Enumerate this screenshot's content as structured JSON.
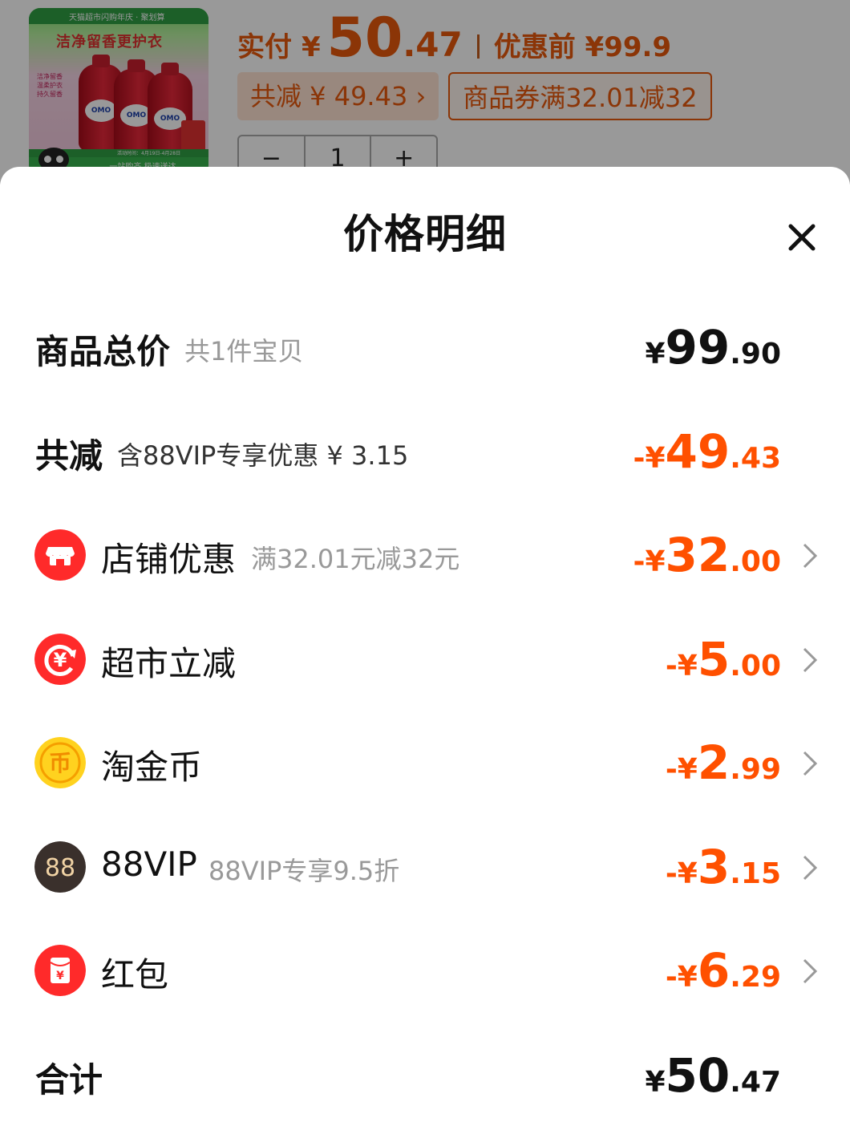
{
  "background": {
    "product_banner_text": "天猫超市闪购年庆 · 聚划算",
    "product_slogan": "洁净留香更护衣",
    "product_side_note": "洁净留香 温柔护衣 持久留香",
    "product_date_text": "活动时间：4月19日-4月28日",
    "product_ship_text": "一站购齐 极速送达",
    "bottle_label": "OMO",
    "pay_label": "实付",
    "pay_yen": "¥",
    "pay_int": "50",
    "pay_dec": ".47",
    "before_label": "优惠前 ¥99.9",
    "chip_discount": "共减 ¥ 49.43 ›",
    "chip_coupon": "商品券满32.01减32",
    "stepper_minus": "−",
    "stepper_qty": "1",
    "stepper_plus": "+"
  },
  "sheet": {
    "title": "价格明细"
  },
  "rows": {
    "total": {
      "title": "商品总价",
      "sub": "共1件宝贝",
      "yen": "¥",
      "int": "99",
      "dec": ".90"
    },
    "discount": {
      "title": "共减",
      "sub": "含88VIP专享优惠 ¥ 3.15",
      "yen": "-¥",
      "int": "49",
      "dec": ".43"
    },
    "shop": {
      "title": "店铺优惠",
      "sub": "满32.01元减32元",
      "yen": "-¥",
      "int": "32",
      "dec": ".00"
    },
    "market": {
      "title": "超市立减",
      "sub": "",
      "yen": "-¥",
      "int": "5",
      "dec": ".00"
    },
    "coin": {
      "title": "淘金币",
      "sub": "",
      "yen": "-¥",
      "int": "2",
      "dec": ".99"
    },
    "vip": {
      "title": "88VIP",
      "sub": "88VIP专享9.5折",
      "icon_text": "88",
      "yen": "-¥",
      "int": "3",
      "dec": ".15"
    },
    "redpack": {
      "title": "红包",
      "sub": "",
      "yen": "-¥",
      "int": "6",
      "dec": ".29"
    },
    "sum": {
      "title": "合计",
      "yen": "¥",
      "int": "50",
      "dec": ".47"
    }
  },
  "icons": {
    "close": "close-icon",
    "shop": "shop-icon",
    "market": "yuan-cycle-icon",
    "coin": "coin-icon",
    "vip": "vip-88-icon",
    "redpack": "red-envelope-icon",
    "chevron": "chevron-right-icon"
  },
  "colors": {
    "discount_orange": "#ff5000",
    "shop_red": "#ff2a2a",
    "coin_yellow": "#ffd21f",
    "vip_dark": "#3a302c"
  }
}
